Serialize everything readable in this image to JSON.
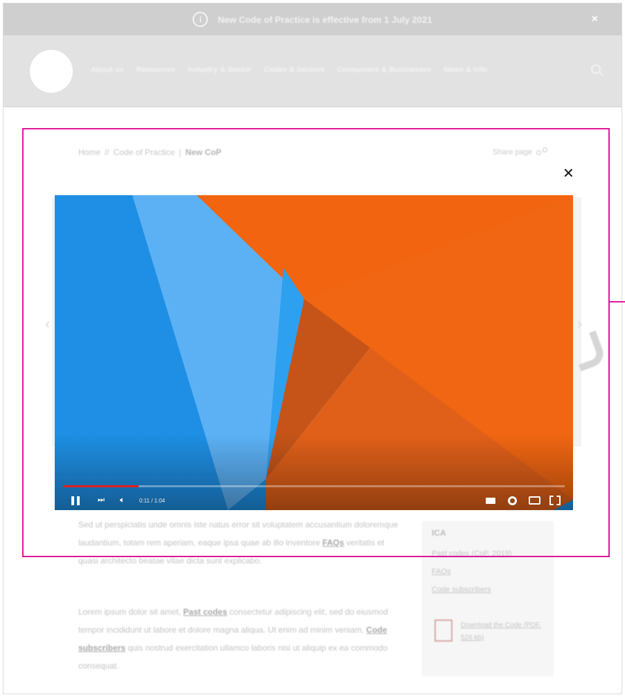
{
  "banner": {
    "icon": "info-circle-icon",
    "text": "New Code of Practice is effective from 1 July 2021",
    "close": "×"
  },
  "nav": {
    "items": [
      "About us",
      "Resources",
      "Industry & Sector",
      "Codes & Sectors",
      "Consumers & Businesses",
      "News & Info"
    ]
  },
  "breadcrumb": {
    "home": "Home",
    "parent": "Code of Practice",
    "sep": "|",
    "current": "New CoP"
  },
  "share": {
    "label": "Share page"
  },
  "modal": {
    "close": "✕"
  },
  "video": {
    "time": "0:11 / 1:04",
    "progress": 0.15,
    "accent": "#e21e1e"
  },
  "content": {
    "p1_a": "Sed ut perspiciatis unde omnis iste natus error sit voluptatem accusantium doloremque laudantium, totam rem aperiam, eaque ipsa quae ab illo inventore ",
    "p1_link": "FAQs",
    "p1_b": " veritatis et quasi architecto beatae vitae dicta sunt explicabo.",
    "p2_a": "Lorem ipsum dolor sit amet, ",
    "p2_link1": "Past codes",
    "p2_b": " consectetur adipiscing elit, sed do eiusmod tempor incididunt ut labore et dolore magna aliqua. Ut enim ad minim veniam, ",
    "p2_link2": "Code subscribers",
    "p2_c": " quis nostrud exercitation ullamco laboris nisi ut aliquip ex ea commodo consequat."
  },
  "sidebar": {
    "title": "ICA",
    "links": [
      "Past codes (CoP, 2019)",
      "FAQs",
      "Code subscribers"
    ],
    "download": "Download the Code (PDF, 526 kb)"
  },
  "colors": {
    "highlight": "#e0169a",
    "orange": "#f26a1b",
    "blue": "#1e90e6"
  }
}
